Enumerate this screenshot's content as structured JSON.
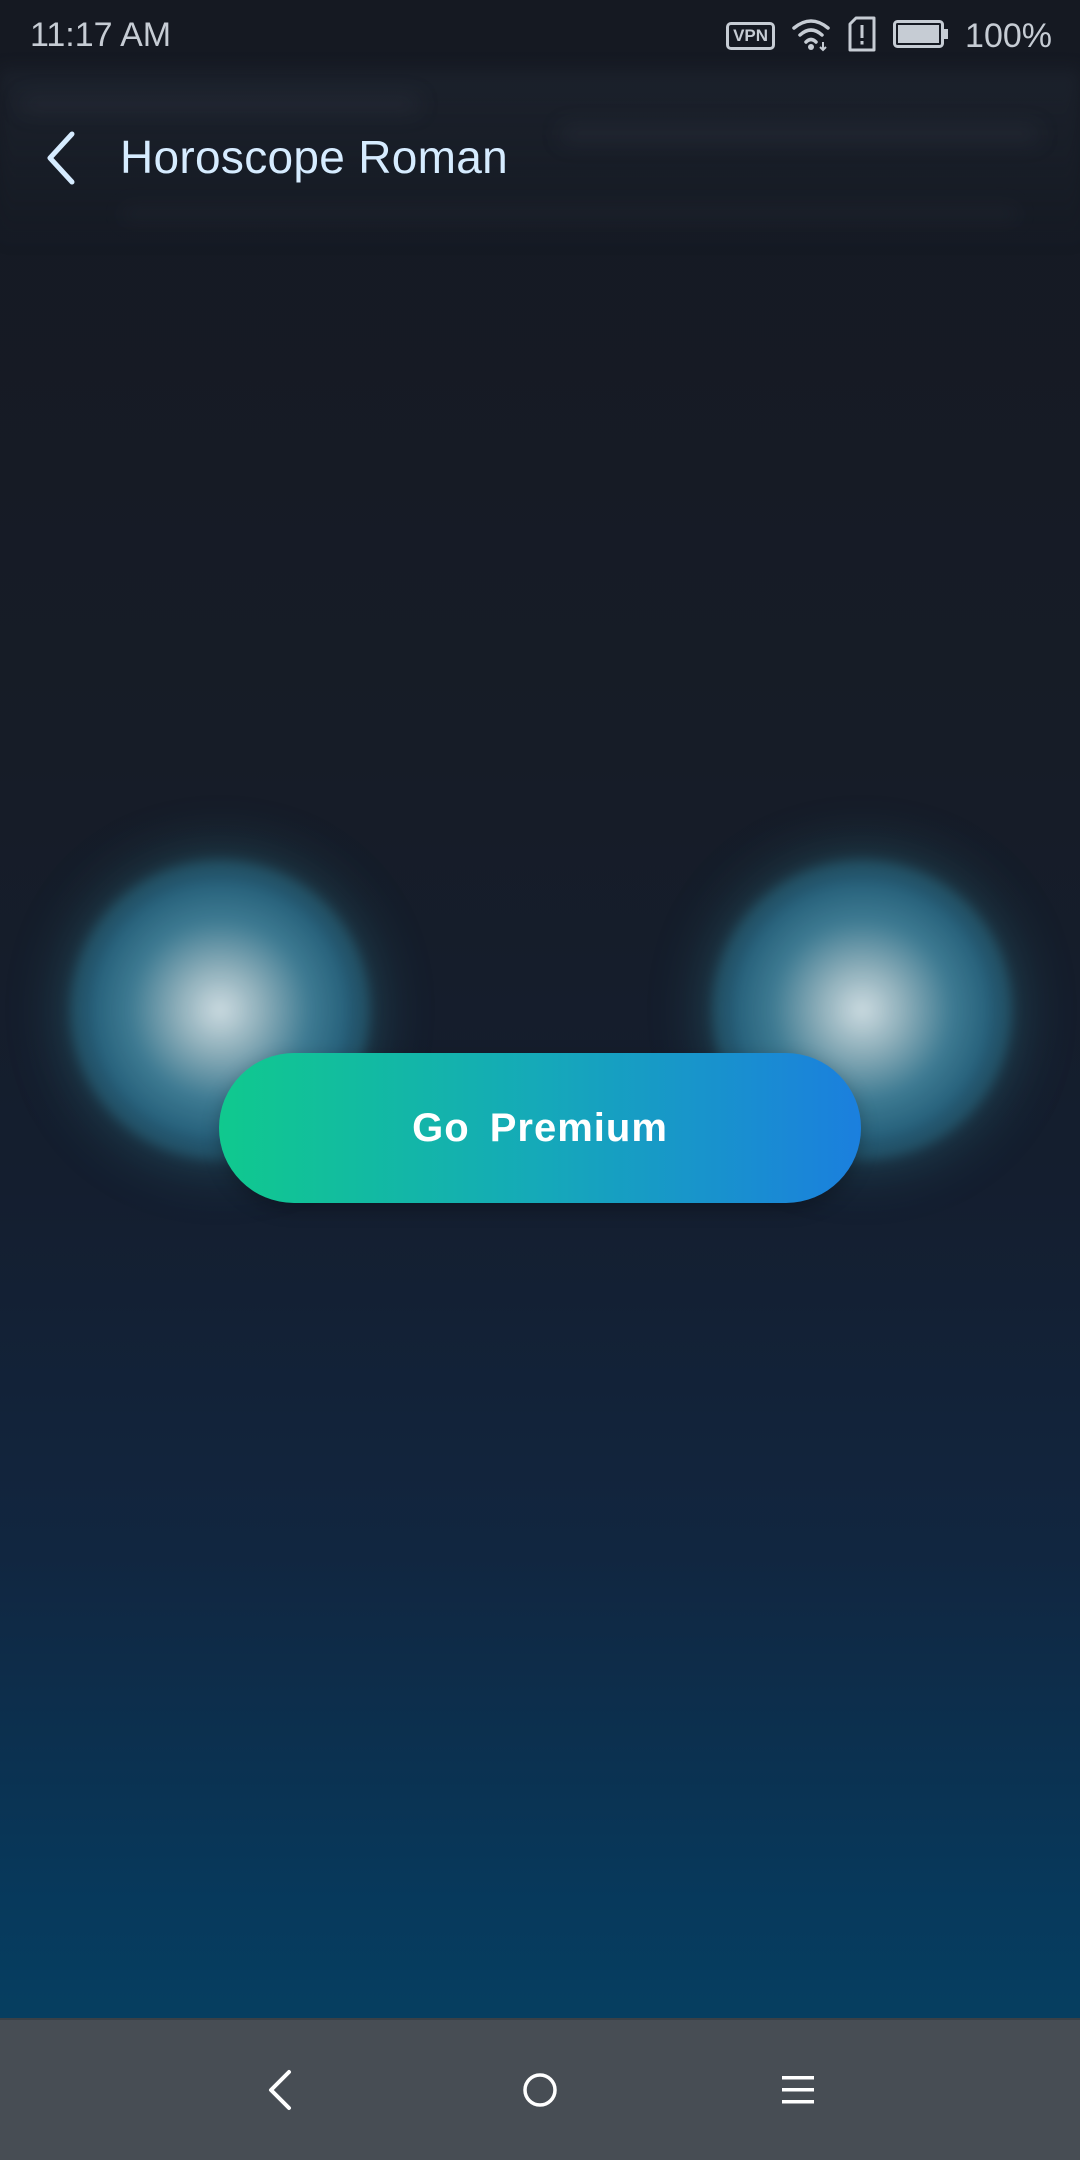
{
  "status_bar": {
    "time": "11:17 AM",
    "vpn_label": "VPN",
    "battery_percent": "100%",
    "icons": [
      "vpn-icon",
      "wifi-icon",
      "sim-alert-icon",
      "battery-icon"
    ]
  },
  "app_bar": {
    "back_icon": "chevron-left-icon",
    "title": "Horoscope Roman"
  },
  "cta": {
    "label": "Go  Premium"
  },
  "nav_bar": {
    "icons": [
      "back-icon",
      "home-icon",
      "menu-icon"
    ]
  },
  "colors": {
    "title_text": "#d6ecff",
    "button_gradient_start": "#10c98e",
    "button_gradient_end": "#1b7fde",
    "nav_bar_bg": "#474d54"
  }
}
